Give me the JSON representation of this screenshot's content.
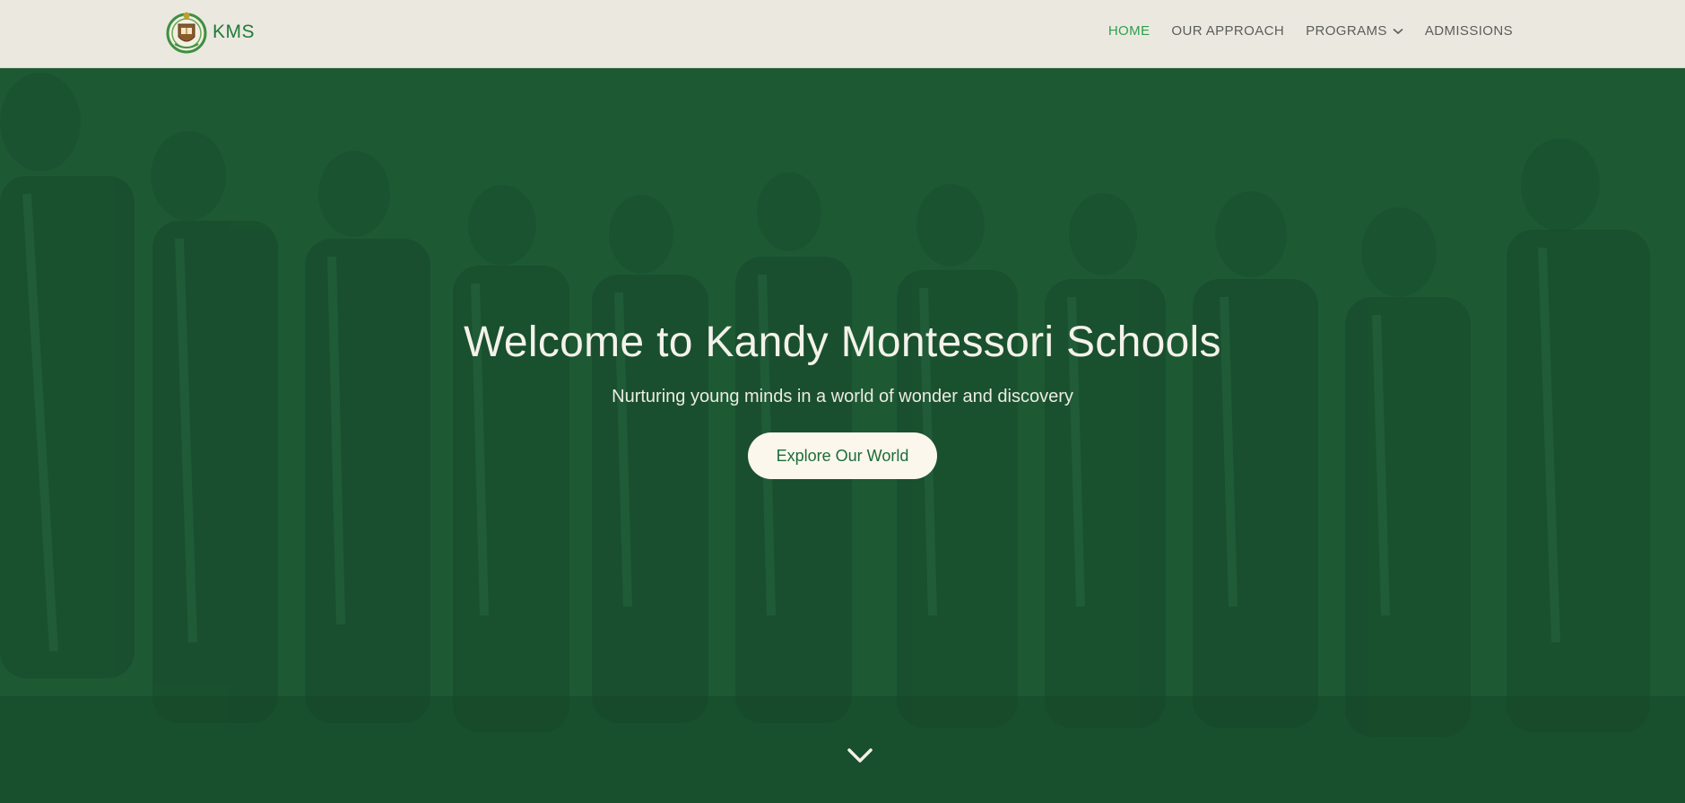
{
  "brand": {
    "name": "KMS",
    "logo_icon": "school-crest-icon"
  },
  "nav": {
    "items": [
      {
        "label": "HOME",
        "active": true
      },
      {
        "label": "OUR APPROACH",
        "active": false
      },
      {
        "label": "PROGRAMS",
        "active": false,
        "has_dropdown": true
      },
      {
        "label": "ADMISSIONS",
        "active": false
      }
    ]
  },
  "hero": {
    "title": "Welcome to Kandy Montessori Schools",
    "subtitle": "Nurturing young minds in a world of wonder and discovery",
    "cta_label": "Explore Our World",
    "scroll_icon": "chevron-down-icon"
  },
  "colors": {
    "nav_bg": "#ebe9df",
    "accent": "#2e9e4f",
    "hero_overlay": "#1d5a34",
    "cta_bg": "#fbf7ec",
    "cta_text": "#1d6b3a"
  }
}
